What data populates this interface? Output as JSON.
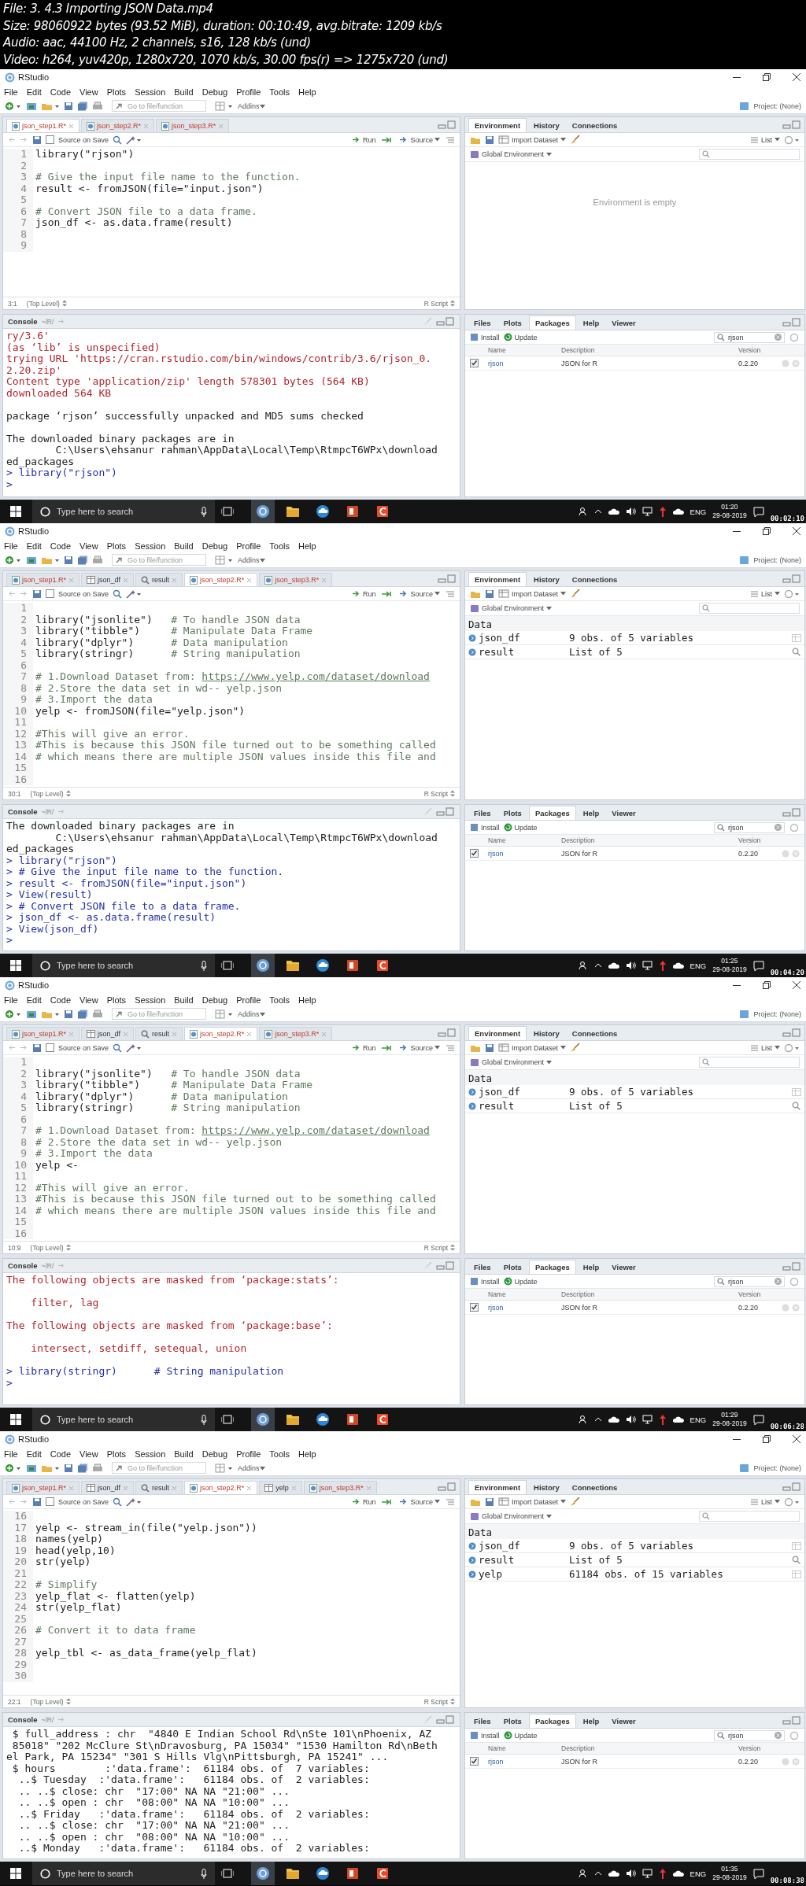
{
  "file_info": [
    "File: 3. 4.3 Importing JSON Data.mp4",
    "Size: 98060922 bytes (93.52 MiB), duration: 00:10:49, avg.bitrate: 1209 kb/s",
    "Audio: aac, 44100 Hz, 2 channels, s16, 128 kb/s (und)",
    "Video: h264, yuv420p, 1280x720, 1070 kb/s, 30.00 fps(r) => 1275x720 (und)"
  ],
  "frames": [
    {
      "title": "RStudio",
      "menu": [
        "File",
        "Edit",
        "Code",
        "View",
        "Plots",
        "Session",
        "Build",
        "Debug",
        "Profile",
        "Tools",
        "Help"
      ],
      "toolbar": {
        "goto_placeholder": "Go to file/function",
        "addins": "Addins",
        "project": "Project: (None)"
      },
      "editor": {
        "tabs": [
          {
            "label": "json_step1.R*",
            "kind": "script",
            "selected": true
          },
          {
            "label": "json_step2.R*",
            "kind": "script",
            "selected": false
          },
          {
            "label": "json_step3.R*",
            "kind": "script",
            "selected": false
          }
        ],
        "source_on_save": {
          "label": "Source on Save",
          "checked": false
        },
        "run": "Run",
        "source": "Source",
        "lines": [
          {
            "num": "1",
            "code": "library(\"rjson\")"
          },
          {
            "num": "2"
          },
          {
            "num": "3",
            "comment": "# Give the input file name to the function."
          },
          {
            "num": "4",
            "code": "result <- fromJSON(file=\"input.json\")"
          },
          {
            "num": "5"
          },
          {
            "num": "6",
            "comment": "# Convert JSON file to a data frame."
          },
          {
            "num": "7",
            "code": "json_df <- as.data.frame(result)"
          },
          {
            "num": "8"
          },
          {
            "num": "9"
          }
        ],
        "position": "3:1",
        "scope": "(Top Level)",
        "file_type": "R Script"
      },
      "env": {
        "tabs": [
          {
            "label": "Environment",
            "selected": true
          },
          {
            "label": "History",
            "selected": false
          },
          {
            "label": "Connections",
            "selected": false
          }
        ],
        "import": "Import Dataset",
        "view": "List",
        "scope": "Global Environment",
        "empty_message": "Environment is empty"
      },
      "console": {
        "title": "Console",
        "path": "~/R/",
        "lines": [
          {
            "kind": "message",
            "text": "ry/3.6'"
          },
          {
            "kind": "message",
            "text": "(as ‘lib’ is unspecified)"
          },
          {
            "kind": "message",
            "text": "trying URL 'https://cran.rstudio.com/bin/windows/contrib/3.6/rjson_0."
          },
          {
            "kind": "message",
            "text": "2.20.zip'"
          },
          {
            "kind": "message",
            "text": "Content type 'application/zip' length 578301 bytes (564 KB)"
          },
          {
            "kind": "message",
            "text": "downloaded 564 KB"
          },
          {
            "kind": "blank"
          },
          {
            "kind": "output",
            "text": "package ‘rjson’ successfully unpacked and MD5 sums checked"
          },
          {
            "kind": "blank"
          },
          {
            "kind": "output",
            "text": "The downloaded binary packages are in"
          },
          {
            "kind": "output",
            "text": "        C:\\Users\\ehsanur rahman\\AppData\\Local\\Temp\\RtmpcT6WPx\\download"
          },
          {
            "kind": "output",
            "text": "ed_packages"
          },
          {
            "kind": "input",
            "text": "> library(\"rjson\")"
          },
          {
            "kind": "input",
            "text": ">"
          }
        ]
      },
      "packages": {
        "tabs": [
          {
            "label": "Files",
            "selected": false
          },
          {
            "label": "Plots",
            "selected": false
          },
          {
            "label": "Packages",
            "selected": true
          },
          {
            "label": "Help",
            "selected": false
          },
          {
            "label": "Viewer",
            "selected": false
          }
        ],
        "install": "Install",
        "update": "Update",
        "search": "rjson",
        "columns": [
          "Name",
          "Description",
          "Version"
        ],
        "rows": [
          {
            "name": "rjson",
            "description": "JSON for R",
            "version": "0.2.20",
            "checked": true
          }
        ]
      },
      "taskbar": {
        "search_placeholder": "Type here to search",
        "language": "ENG",
        "time": "01:20",
        "date": "29-08-2019"
      },
      "timestamp": "00:02:10"
    },
    {
      "title": "RStudio",
      "menu": [
        "File",
        "Edit",
        "Code",
        "View",
        "Plots",
        "Session",
        "Build",
        "Debug",
        "Profile",
        "Tools",
        "Help"
      ],
      "toolbar": {
        "goto_placeholder": "Go to file/function",
        "addins": "Addins",
        "project": "Project: (None)"
      },
      "editor": {
        "tabs": [
          {
            "label": "json_step1.R*",
            "kind": "script",
            "selected": false
          },
          {
            "label": "json_df",
            "kind": "data",
            "selected": false
          },
          {
            "label": "result",
            "kind": "view",
            "selected": false
          },
          {
            "label": "json_step2.R*",
            "kind": "script",
            "selected": true
          },
          {
            "label": "json_step3.R*",
            "kind": "script",
            "selected": false
          }
        ],
        "source_on_save": {
          "label": "Source on Save",
          "checked": false
        },
        "run": "Run",
        "source": "Source",
        "lines": [
          {
            "num": "1"
          },
          {
            "num": "2",
            "code": "library(\"jsonlite\")",
            "comment": "# To handle JSON data"
          },
          {
            "num": "3",
            "code": "library(\"tibble\")",
            "comment": "# Manipulate Data Frame"
          },
          {
            "num": "4",
            "code": "library(\"dplyr\")",
            "comment": "# Data manipulation"
          },
          {
            "num": "5",
            "code": "library(stringr)",
            "comment": "# String manipulation"
          },
          {
            "num": "6"
          },
          {
            "num": "7",
            "comment": "# 1.Download Dataset from: ",
            "link": "https://www.yelp.com/dataset/download"
          },
          {
            "num": "8",
            "comment": "# 2.Store the data set in wd-- yelp.json"
          },
          {
            "num": "9",
            "comment": "# 3.Import the data"
          },
          {
            "num": "10",
            "code": "yelp <- fromJSON(file=\"yelp.json\")"
          },
          {
            "num": "11"
          },
          {
            "num": "12",
            "comment": "#This will give an error."
          },
          {
            "num": "13",
            "comment": "#This is because this JSON file turned out to be something called"
          },
          {
            "num": "14",
            "comment": "# which means there are multiple JSON values inside this file and"
          },
          {
            "num": "15"
          },
          {
            "num": "16"
          }
        ],
        "position": "30:1",
        "scope": "(Top Level)",
        "file_type": "R Script"
      },
      "env": {
        "tabs": [
          {
            "label": "Environment",
            "selected": true
          },
          {
            "label": "History",
            "selected": false
          },
          {
            "label": "Connections",
            "selected": false
          }
        ],
        "import": "Import Dataset",
        "view": "List",
        "scope": "Global Environment",
        "heading": "Data",
        "rows": [
          {
            "name": "json_df",
            "value": "9 obs. of 5 variables",
            "kind": "data"
          },
          {
            "name": "result",
            "value": "List of 5",
            "kind": "list"
          }
        ]
      },
      "console": {
        "title": "Console",
        "path": "~/R/",
        "lines": [
          {
            "kind": "output",
            "text": "The downloaded binary packages are in"
          },
          {
            "kind": "output",
            "text": "        C:\\Users\\ehsanur rahman\\AppData\\Local\\Temp\\RtmpcT6WPx\\download"
          },
          {
            "kind": "output",
            "text": "ed_packages"
          },
          {
            "kind": "input",
            "text": "> library(\"rjson\")"
          },
          {
            "kind": "input",
            "text": "> # Give the input file name to the function."
          },
          {
            "kind": "input",
            "text": "> result <- fromJSON(file=\"input.json\")"
          },
          {
            "kind": "input",
            "text": "> View(result)"
          },
          {
            "kind": "input",
            "text": "> # Convert JSON file to a data frame."
          },
          {
            "kind": "input",
            "text": "> json_df <- as.data.frame(result)"
          },
          {
            "kind": "input",
            "text": "> View(json_df)"
          },
          {
            "kind": "input",
            "text": ">"
          }
        ]
      },
      "packages": {
        "tabs": [
          {
            "label": "Files",
            "selected": false
          },
          {
            "label": "Plots",
            "selected": false
          },
          {
            "label": "Packages",
            "selected": true
          },
          {
            "label": "Help",
            "selected": false
          },
          {
            "label": "Viewer",
            "selected": false
          }
        ],
        "install": "Install",
        "update": "Update",
        "search": "rjson",
        "columns": [
          "Name",
          "Description",
          "Version"
        ],
        "rows": [
          {
            "name": "rjson",
            "description": "JSON for R",
            "version": "0.2.20",
            "checked": true
          }
        ]
      },
      "taskbar": {
        "search_placeholder": "Type here to search",
        "language": "ENG",
        "time": "01:25",
        "date": "29-08-2019"
      },
      "timestamp": "00:04:20"
    },
    {
      "title": "RStudio",
      "menu": [
        "File",
        "Edit",
        "Code",
        "View",
        "Plots",
        "Session",
        "Build",
        "Debug",
        "Profile",
        "Tools",
        "Help"
      ],
      "toolbar": {
        "goto_placeholder": "Go to file/function",
        "addins": "Addins",
        "project": "Project: (None)"
      },
      "editor": {
        "tabs": [
          {
            "label": "json_step1.R*",
            "kind": "script",
            "selected": false
          },
          {
            "label": "json_df",
            "kind": "data",
            "selected": false
          },
          {
            "label": "result",
            "kind": "view",
            "selected": false
          },
          {
            "label": "json_step2.R*",
            "kind": "script",
            "selected": true
          },
          {
            "label": "json_step3.R*",
            "kind": "script",
            "selected": false
          }
        ],
        "source_on_save": {
          "label": "Source on Save",
          "checked": false
        },
        "run": "Run",
        "source": "Source",
        "lines": [
          {
            "num": "1"
          },
          {
            "num": "2",
            "code": "library(\"jsonlite\")",
            "comment": "# To handle JSON data"
          },
          {
            "num": "3",
            "code": "library(\"tibble\")",
            "comment": "# Manipulate Data Frame"
          },
          {
            "num": "4",
            "code": "library(\"dplyr\")",
            "comment": "# Data manipulation"
          },
          {
            "num": "5",
            "code": "library(stringr)",
            "comment": "# String manipulation"
          },
          {
            "num": "6"
          },
          {
            "num": "7",
            "comment": "# 1.Download Dataset from: ",
            "link": "https://www.yelp.com/dataset/download"
          },
          {
            "num": "8",
            "comment": "# 2.Store the data set in wd-- yelp.json"
          },
          {
            "num": "9",
            "comment": "# 3.Import the data"
          },
          {
            "num": "10",
            "code": "yelp <-"
          },
          {
            "num": "11"
          },
          {
            "num": "12",
            "comment": "#This will give an error."
          },
          {
            "num": "13",
            "comment": "#This is because this JSON file turned out to be something called"
          },
          {
            "num": "14",
            "comment": "# which means there are multiple JSON values inside this file and"
          },
          {
            "num": "15"
          },
          {
            "num": "16"
          }
        ],
        "position": "10:9",
        "scope": "(Top Level)",
        "file_type": "R Script"
      },
      "env": {
        "tabs": [
          {
            "label": "Environment",
            "selected": true
          },
          {
            "label": "History",
            "selected": false
          },
          {
            "label": "Connections",
            "selected": false
          }
        ],
        "import": "Import Dataset",
        "view": "List",
        "scope": "Global Environment",
        "heading": "Data",
        "rows": [
          {
            "name": "json_df",
            "value": "9 obs. of 5 variables",
            "kind": "data"
          },
          {
            "name": "result",
            "value": "List of 5",
            "kind": "list"
          }
        ]
      },
      "console": {
        "title": "Console",
        "path": "~/R/",
        "lines": [
          {
            "kind": "message",
            "text": "The following objects are masked from ‘package:stats’:"
          },
          {
            "kind": "blank"
          },
          {
            "kind": "message",
            "text": "    filter, lag"
          },
          {
            "kind": "blank"
          },
          {
            "kind": "message",
            "text": "The following objects are masked from ‘package:base’:"
          },
          {
            "kind": "blank"
          },
          {
            "kind": "message",
            "text": "    intersect, setdiff, setequal, union"
          },
          {
            "kind": "blank"
          },
          {
            "kind": "input",
            "text": "> library(stringr)      # String manipulation"
          },
          {
            "kind": "input",
            "text": ">"
          }
        ]
      },
      "packages": {
        "tabs": [
          {
            "label": "Files",
            "selected": false
          },
          {
            "label": "Plots",
            "selected": false
          },
          {
            "label": "Packages",
            "selected": true
          },
          {
            "label": "Help",
            "selected": false
          },
          {
            "label": "Viewer",
            "selected": false
          }
        ],
        "install": "Install",
        "update": "Update",
        "search": "rjson",
        "columns": [
          "Name",
          "Description",
          "Version"
        ],
        "rows": [
          {
            "name": "rjson",
            "description": "JSON for R",
            "version": "0.2.20",
            "checked": true
          }
        ]
      },
      "taskbar": {
        "search_placeholder": "Type here to search",
        "language": "ENG",
        "time": "01:29",
        "date": "29-08-2019"
      },
      "timestamp": "00:06:28"
    },
    {
      "title": "RStudio",
      "menu": [
        "File",
        "Edit",
        "Code",
        "View",
        "Plots",
        "Session",
        "Build",
        "Debug",
        "Profile",
        "Tools",
        "Help"
      ],
      "toolbar": {
        "goto_placeholder": "Go to file/function",
        "addins": "Addins",
        "project": "Project: (None)"
      },
      "editor": {
        "tabs": [
          {
            "label": "json_step1.R*",
            "kind": "script",
            "selected": false
          },
          {
            "label": "json_df",
            "kind": "data",
            "selected": false
          },
          {
            "label": "result",
            "kind": "view",
            "selected": false
          },
          {
            "label": "json_step2.R*",
            "kind": "script",
            "selected": true
          },
          {
            "label": "yelp",
            "kind": "data",
            "selected": false
          },
          {
            "label": "json_step3.R*",
            "kind": "script",
            "selected": false
          }
        ],
        "source_on_save": {
          "label": "Source on Save",
          "checked": false
        },
        "run": "Run",
        "source": "Source",
        "lines": [
          {
            "num": "16"
          },
          {
            "num": "17",
            "code": "yelp <- stream_in(file(\"yelp.json\"))"
          },
          {
            "num": "18",
            "code": "names(yelp)"
          },
          {
            "num": "19",
            "code": "head(yelp,10)"
          },
          {
            "num": "20",
            "code": "str(yelp)"
          },
          {
            "num": "21"
          },
          {
            "num": "22",
            "comment": "# Simplify"
          },
          {
            "num": "23",
            "code": "yelp_flat <- flatten(yelp)"
          },
          {
            "num": "24",
            "code": "str(yelp_flat)"
          },
          {
            "num": "25"
          },
          {
            "num": "26",
            "comment": "# Convert it to data frame"
          },
          {
            "num": "27"
          },
          {
            "num": "28",
            "code": "yelp_tbl <- as_data_frame(yelp_flat)"
          },
          {
            "num": "29"
          },
          {
            "num": "30"
          }
        ],
        "position": "22:1",
        "scope": "(Top Level)",
        "file_type": "R Script"
      },
      "env": {
        "tabs": [
          {
            "label": "Environment",
            "selected": true
          },
          {
            "label": "History",
            "selected": false
          },
          {
            "label": "Connections",
            "selected": false
          }
        ],
        "import": "Import Dataset",
        "view": "List",
        "scope": "Global Environment",
        "heading": "Data",
        "rows": [
          {
            "name": "json_df",
            "value": "9 obs. of 5 variables",
            "kind": "data"
          },
          {
            "name": "result",
            "value": "List of 5",
            "kind": "list"
          },
          {
            "name": "yelp",
            "value": "61184 obs. of 15 variables",
            "kind": "data"
          }
        ]
      },
      "console": {
        "title": "Console",
        "path": "~/R/",
        "lines": [
          {
            "kind": "output",
            "text": " $ full_address : chr  \"4840 E Indian School Rd\\nSte 101\\nPhoenix, AZ"
          },
          {
            "kind": "output",
            "text": " 85018\" \"202 McClure St\\nDravosburg, PA 15034\" \"1530 Hamilton Rd\\nBeth"
          },
          {
            "kind": "output",
            "text": "el Park, PA 15234\" \"301 S Hills Vlg\\nPittsburgh, PA 15241\" ..."
          },
          {
            "kind": "output",
            "text": " $ hours        :'data.frame':  61184 obs. of  7 variables:"
          },
          {
            "kind": "output",
            "text": "  ..$ Tuesday  :'data.frame':   61184 obs. of  2 variables:"
          },
          {
            "kind": "output",
            "text": "  .. ..$ close: chr  \"17:00\" NA NA \"21:00\" ..."
          },
          {
            "kind": "output",
            "text": "  .. ..$ open : chr  \"08:00\" NA NA \"10:00\" ..."
          },
          {
            "kind": "output",
            "text": "  ..$ Friday   :'data.frame':   61184 obs. of  2 variables:"
          },
          {
            "kind": "output",
            "text": "  .. ..$ close: chr  \"17:00\" NA NA \"21:00\" ..."
          },
          {
            "kind": "output",
            "text": "  .. ..$ open : chr  \"08:00\" NA NA \"10:00\" ..."
          },
          {
            "kind": "output",
            "text": "  ..$ Monday   :'data.frame':   61184 obs. of  2 variables:"
          }
        ]
      },
      "packages": {
        "tabs": [
          {
            "label": "Files",
            "selected": false
          },
          {
            "label": "Plots",
            "selected": false
          },
          {
            "label": "Packages",
            "selected": true
          },
          {
            "label": "Help",
            "selected": false
          },
          {
            "label": "Viewer",
            "selected": false
          }
        ],
        "install": "Install",
        "update": "Update",
        "search": "rjson",
        "columns": [
          "Name",
          "Description",
          "Version"
        ],
        "rows": [
          {
            "name": "rjson",
            "description": "JSON for R",
            "version": "0.2.20",
            "checked": true
          }
        ]
      },
      "taskbar": {
        "search_placeholder": "Type here to search",
        "language": "ENG",
        "time": "01:35",
        "date": "29-08-2019"
      },
      "timestamp": "00:08:38"
    }
  ]
}
